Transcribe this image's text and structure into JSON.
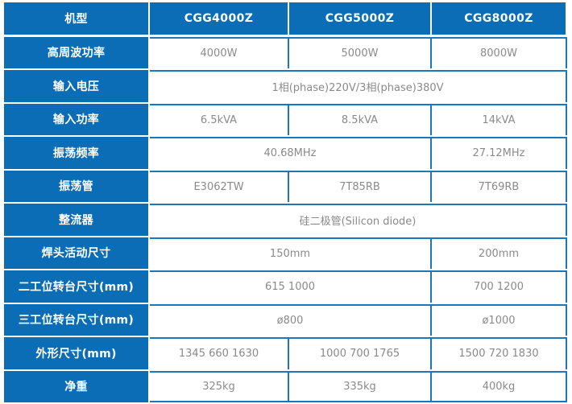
{
  "table": {
    "header": {
      "label": "机型",
      "models": [
        "CGG4000Z",
        "CGG5000Z",
        "CGG8000Z"
      ]
    },
    "rows": [
      {
        "label": "高周波功率",
        "cells": [
          {
            "text": "4000W",
            "span": 1
          },
          {
            "text": "5000W",
            "span": 1
          },
          {
            "text": "8000W",
            "span": 1
          }
        ]
      },
      {
        "label": "输入电压",
        "cells": [
          {
            "text": "1相(phase)220V/3相(phase)380V",
            "span": 3
          }
        ]
      },
      {
        "label": "输入功率",
        "cells": [
          {
            "text": "6.5kVA",
            "span": 1
          },
          {
            "text": "8.5kVA",
            "span": 1
          },
          {
            "text": "14kVA",
            "span": 1
          }
        ]
      },
      {
        "label": "振荡频率",
        "cells": [
          {
            "text": "40.68MHz",
            "span": 2
          },
          {
            "text": "27.12MHz",
            "span": 1
          }
        ]
      },
      {
        "label": "振荡管",
        "cells": [
          {
            "text": "E3062TW",
            "span": 1
          },
          {
            "text": "7T85RB",
            "span": 1
          },
          {
            "text": "7T69RB",
            "span": 1
          }
        ]
      },
      {
        "label": "整流器",
        "cells": [
          {
            "text": "硅二极管(Silicon diode)",
            "span": 3
          }
        ]
      },
      {
        "label": "焊头活动尺寸",
        "cells": [
          {
            "text": "150mm",
            "span": 2
          },
          {
            "text": "200mm",
            "span": 1
          }
        ]
      },
      {
        "label": "二工位转台尺寸(mm)",
        "cells": [
          {
            "text": "615 1000",
            "span": 2
          },
          {
            "text": "700 1200",
            "span": 1
          }
        ]
      },
      {
        "label": "三工位转台尺寸(mm)",
        "cells": [
          {
            "text": "ø800",
            "span": 2
          },
          {
            "text": "ø1000",
            "span": 1
          }
        ]
      },
      {
        "label": "外形尺寸(mm)",
        "cells": [
          {
            "text": "1345 660 1630",
            "span": 1
          },
          {
            "text": "1000 700 1765",
            "span": 1
          },
          {
            "text": "1500 720 1830",
            "span": 1
          }
        ]
      },
      {
        "label": "净重",
        "cells": [
          {
            "text": "325kg",
            "span": 1
          },
          {
            "text": "335kg",
            "span": 1
          },
          {
            "text": "400kg",
            "span": 1
          }
        ]
      }
    ]
  },
  "colors": {
    "header_blue": "#0b6db6",
    "border_blue": "#1a76bd",
    "value_text": "#8a8a8a",
    "label_text": "#ffffff"
  }
}
